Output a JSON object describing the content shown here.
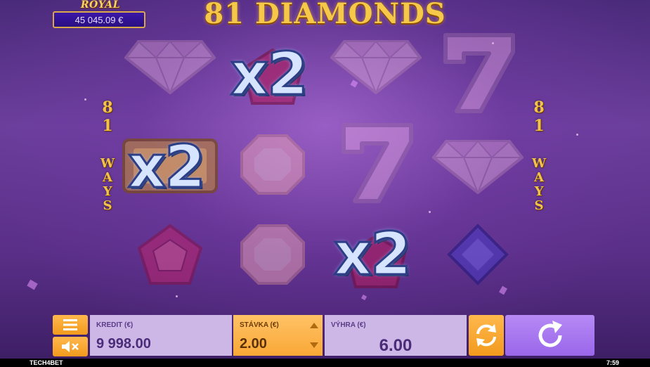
{
  "jackpot": {
    "title": "ROYAL JACKPOT",
    "amount": "45 045.09 €"
  },
  "game": {
    "title": "81 DIAMONDS"
  },
  "ways": {
    "number_digits": [
      "8",
      "1"
    ],
    "word_letters": [
      "W",
      "A",
      "Y",
      "S"
    ]
  },
  "reels": [
    [
      "diamond",
      "bar",
      "ruby-pentagon"
    ],
    [
      "ruby-square",
      "octagon-gem",
      "octagon-gem"
    ],
    [
      "diamond",
      "seven",
      "ruby-square"
    ],
    [
      "seven",
      "diamond",
      "sapphire"
    ]
  ],
  "multipliers": [
    "x2",
    "x2",
    "x2"
  ],
  "controls": {
    "menu_icon": "hamburger-icon",
    "sound_icon": "speaker-mute-icon",
    "credit_label": "KREDIT (€)",
    "credit_value": "9 998.00",
    "stake_label": "STÁVKA (€)",
    "stake_value": "2.00",
    "win_label": "VÝHRA (€)",
    "win_value": "6.00",
    "autoplay_icon": "autoplay-icon",
    "spin_icon": "spin-icon"
  },
  "footer": {
    "brand": "TECH4BET",
    "time": "7:59"
  },
  "colors": {
    "accent_orange": "#f29a1d",
    "spin_purple": "#a876f0",
    "title_gold": "#f6c84a"
  }
}
